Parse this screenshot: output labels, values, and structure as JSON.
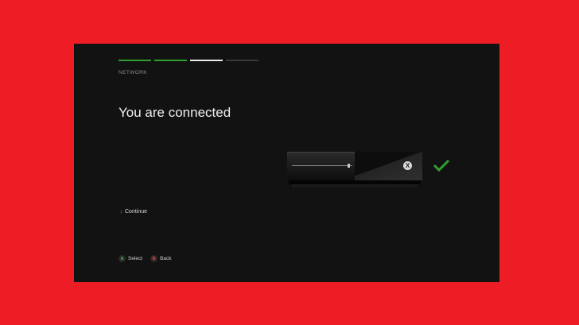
{
  "setup": {
    "section_label": "NETWORK",
    "title": "You are connected",
    "steps": [
      "done",
      "done",
      "current",
      "pending"
    ],
    "continue_label": "Continue"
  },
  "hints": {
    "a_button": "A",
    "a_label": "Select",
    "b_button": "B",
    "b_label": "Back"
  },
  "console": {
    "logo_glyph": "X"
  },
  "icons": {
    "status": "checkmark-icon",
    "continue": "chevron-right-icon"
  },
  "colors": {
    "frame": "#ee1c25",
    "screen": "#121212",
    "accent": "#2f9e2f"
  }
}
